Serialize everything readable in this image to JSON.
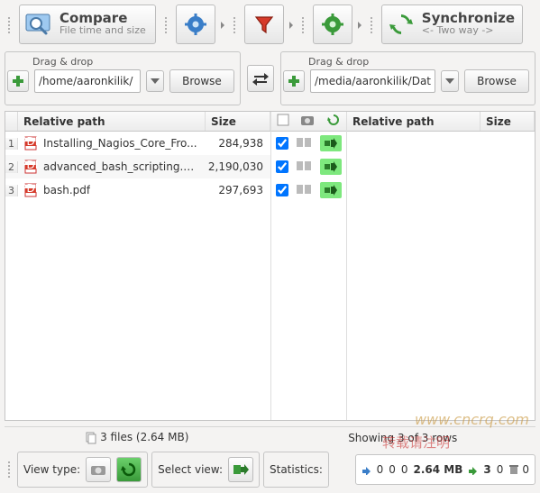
{
  "toolbar": {
    "compare": {
      "title": "Compare",
      "subtitle": "File time and size"
    },
    "synchronize": {
      "title": "Synchronize",
      "subtitle": "<- Two way ->"
    }
  },
  "paths": {
    "drag_label": "Drag & drop",
    "left": "/home/aaronkilik/",
    "right": "/media/aaronkilik/Dat",
    "browse": "Browse"
  },
  "grid": {
    "headers": {
      "relpath": "Relative path",
      "size": "Size"
    },
    "rows": [
      {
        "n": "1",
        "name": "Installing_Nagios_Core_Fro...",
        "size": "284,938"
      },
      {
        "n": "2",
        "name": "advanced_bash_scripting.pdf",
        "size": "2,190,030"
      },
      {
        "n": "3",
        "name": "bash.pdf",
        "size": "297,693"
      }
    ]
  },
  "status": {
    "files": "3 files  (2.64 MB)",
    "rows": "Showing 3 of 3 rows"
  },
  "bottom": {
    "view_type": "View type:",
    "select_view": "Select view:",
    "statistics": "Statistics:",
    "stats": [
      "0",
      "0",
      "0",
      "2.64 MB",
      "3",
      "0",
      "0"
    ]
  },
  "watermarks": {
    "a": "www.cncrq.com",
    "b": "转载请注明"
  }
}
